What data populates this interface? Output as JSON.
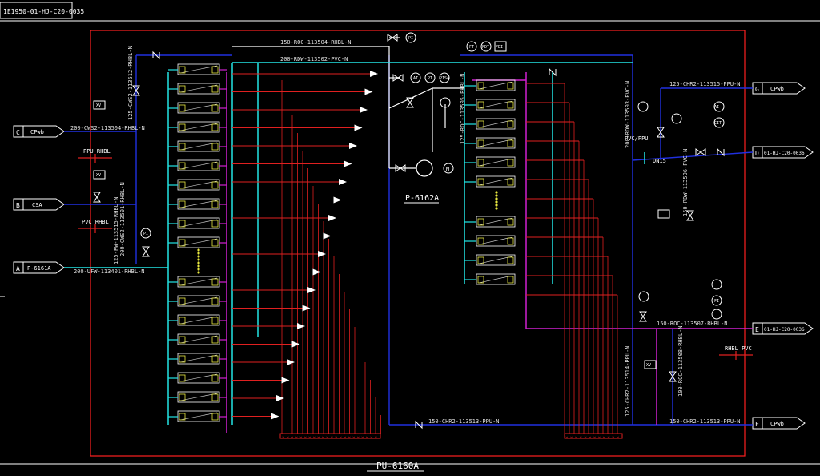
{
  "title_block": "1E1950-01-HJ-C20-0035",
  "package_label": "PU-6160A",
  "pump_label": "P-6162A",
  "pipe_labels": {
    "top_roc": "150-ROC-113504-RHBL-N",
    "top_rdw": "200-RDW-113502-PVC-N",
    "left_cws": "200-CWS2-113504-RHBL-N",
    "left_vert_1": "125-CWS2-113512-RHBL-N",
    "left_vert_2": "200-CWS2-113501-RHBL-N",
    "left_vert_3": "125-FW-113515-RHBL-N",
    "left_bottom": "200-UFW-113401-RHBL-N",
    "right_top": "125-CHR2-113515-PPU-N",
    "right_vert_1": "200-RDW-113503-PVC-N",
    "right_vert_2": "150-RDW-113506-PVC-N",
    "right_mid": "150-ROC-113507-RHBL-N",
    "right_vert_3": "125-CHR2-113514-PPU-N",
    "right_vert_4": "100-ROC-113508-RHBL-N",
    "bottom_chr": "150-CHR2-113513-PPU-N",
    "bottom_right": "150-CHR2-113513-PPU-N",
    "mid_roc": "125-ROC-113505-RHBL-N"
  },
  "connectors": {
    "C": {
      "letter": "C",
      "text": "CPwb"
    },
    "B": {
      "letter": "B",
      "text": "CSA"
    },
    "A": {
      "letter": "A",
      "text": "P-6161A"
    },
    "G": {
      "letter": "G",
      "text": "CPwb"
    },
    "D": {
      "letter": "D",
      "text": "01-HJ-C20-0036"
    },
    "E": {
      "letter": "E",
      "text": "01-HJ-C20-0036"
    },
    "F": {
      "letter": "F",
      "text": "CPwb"
    }
  },
  "material_tags": {
    "ppu_rhbl": "PPU RHBL",
    "pvc_rhbl": "PVC RHBL",
    "pvc_ppu": "PVC/PPU",
    "rhbl_pvc": "RHBL PVC",
    "dn15": "DN15"
  },
  "instruments": {
    "pi_left": "PI",
    "xv_left_1": "XV",
    "xv_left_2": "XV",
    "at": "AT",
    "ft": "FT",
    "pt": "PT",
    "pisa": "PISA",
    "pi": "PI",
    "pdt": "PDT",
    "fi": "FI",
    "pdi": "PDI",
    "ai": "AI",
    "cit": "CIT",
    "xv_right": "XV",
    "m": "M"
  },
  "colors": {
    "frame": "#ff2020",
    "cyan_pipe": "#22e5e5",
    "red_pipe": "#e02020",
    "magenta_pipe": "#d020d0",
    "blue_pipe": "#2030e0",
    "white": "#ffffff",
    "module_yellow": "#e8e840",
    "annotation": "#e0e0e0"
  },
  "icons": [
    "valve-icon",
    "check-valve-icon",
    "pump-icon",
    "instrument-bubble-icon",
    "flow-arrow-icon",
    "off-page-connector-icon"
  ]
}
